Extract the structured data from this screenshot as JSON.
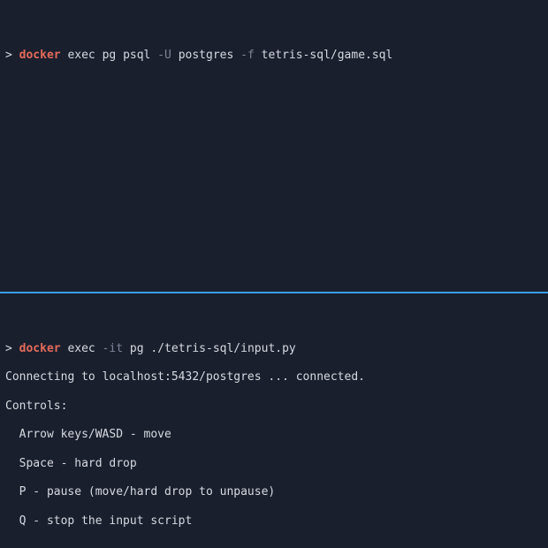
{
  "top_pane": {
    "prompt": ">",
    "command": {
      "keyword": "docker",
      "args1": "exec pg psql",
      "flag1": "-U",
      "args2": "postgres",
      "flag2": "-f",
      "args3": "tetris-sql/game.sql"
    }
  },
  "bottom_pane": {
    "prompt": ">",
    "command": {
      "keyword": "docker",
      "args1": "exec",
      "flag1": "-it",
      "args2": "pg ./tetris-sql/input.py"
    },
    "output": {
      "line1": "Connecting to localhost:5432/postgres ... connected.",
      "line2": "Controls:",
      "line3": "Arrow keys/WASD - move",
      "line4": "Space - hard drop",
      "line5": "P - pause (move/hard drop to unpause)",
      "line6": "Q - stop the input script"
    }
  }
}
